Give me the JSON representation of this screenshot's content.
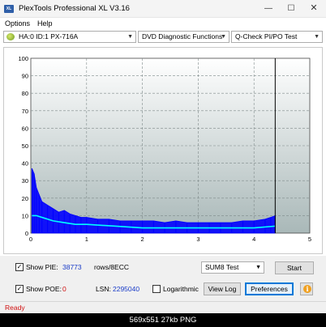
{
  "window": {
    "title": "PlexTools Professional XL V3.16",
    "icon_text": "XL",
    "minimize": "—",
    "maximize": "☐",
    "close": "✕"
  },
  "menu": {
    "options": "Options",
    "help": "Help"
  },
  "toolbar": {
    "drive": "HA:0 ID:1  PX-716A",
    "function": "DVD Diagnostic Functions",
    "test": "Q-Check PI/PO Test"
  },
  "chart_data": {
    "type": "area",
    "x_ticks": [
      "0",
      "1",
      "2",
      "3",
      "4",
      "5"
    ],
    "y_ticks": [
      "0",
      "10",
      "20",
      "30",
      "40",
      "50",
      "60",
      "70",
      "80",
      "90",
      "100"
    ],
    "xlim": [
      0,
      5
    ],
    "ylim": [
      0,
      100
    ],
    "grid": true,
    "end_marker_x": 4.38,
    "colors": {
      "pie": "#0000ff",
      "avg": "#00ffff",
      "marker": "#000000",
      "grid": "#7f8a8a"
    },
    "series": [
      {
        "x": [
          0.02,
          0.06,
          0.1,
          0.15,
          0.2,
          0.3,
          0.4,
          0.5,
          0.6,
          0.7,
          0.8,
          0.9,
          1.0,
          1.2,
          1.4,
          1.6,
          1.8,
          2.0,
          2.2,
          2.4,
          2.6,
          2.8,
          3.0,
          3.2,
          3.4,
          3.6,
          3.8,
          4.0,
          4.2,
          4.3,
          4.38
        ],
        "values": [
          37,
          34,
          26,
          22,
          18,
          16,
          14,
          12,
          13,
          11,
          10,
          9,
          9,
          8,
          8,
          7,
          7,
          7,
          7,
          6,
          7,
          6,
          6,
          6,
          6,
          6,
          7,
          7,
          8,
          9,
          10
        ]
      },
      {
        "x": [
          0.02,
          0.1,
          0.2,
          0.4,
          0.6,
          0.8,
          1.0,
          1.5,
          2.0,
          2.5,
          3.0,
          3.5,
          4.0,
          4.38
        ],
        "values": [
          10,
          10,
          9,
          7,
          6,
          5,
          5,
          4,
          3,
          3,
          3,
          3,
          3,
          4
        ]
      }
    ]
  },
  "controls": {
    "show_pie_label": "Show PIE:",
    "pie_value": "38773",
    "rows_label": "rows/8ECC",
    "test_mode": "SUM8 Test",
    "start": "Start",
    "show_poe_label": "Show POE:",
    "poe_value": "0",
    "lsn_label": "LSN:",
    "lsn_value": "2295040",
    "logarithmic": "Logarithmic",
    "view_log": "View Log",
    "preferences": "Preferences",
    "check_mark": "✓",
    "info": "i"
  },
  "status": {
    "text": "Ready"
  },
  "caption": {
    "text": "569x551  27kb  PNG"
  }
}
